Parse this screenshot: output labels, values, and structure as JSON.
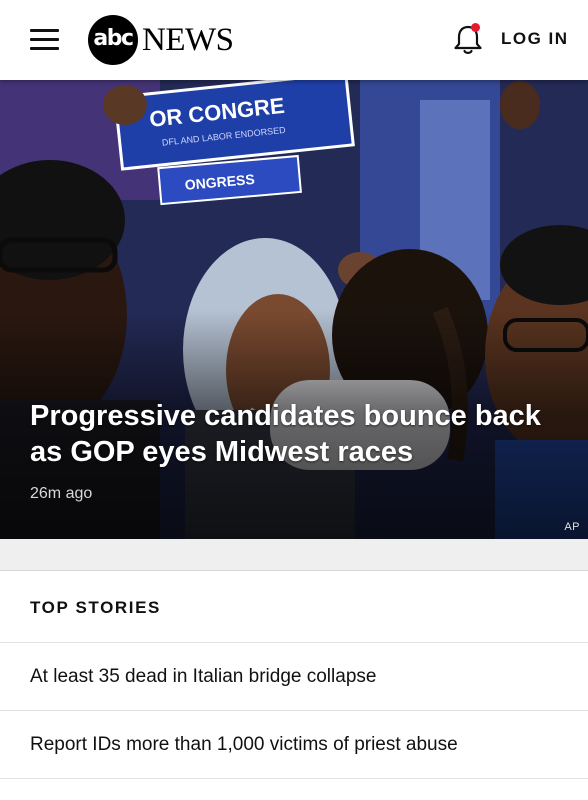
{
  "header": {
    "logo_mark": "abc",
    "logo_text": "NEWS",
    "login_label": "LOG IN",
    "menu_icon": "hamburger-menu-icon",
    "notification_icon": "bell-icon",
    "notification_dot_color": "#e8192c"
  },
  "hero": {
    "headline": "Progressive candidates bounce back as GOP eyes Midwest races",
    "timestamp": "26m ago",
    "credit": "AP",
    "sign_text_1": "OR CONGRE",
    "sign_text_2": "DFL AND LABOR ENDORSED",
    "sign_text_3": "ONGRESS"
  },
  "top_stories": {
    "title": "TOP STORIES",
    "items": [
      {
        "headline": "At least 35 dead in Italian bridge collapse"
      },
      {
        "headline": "Report IDs more than 1,000 victims of priest abuse"
      }
    ]
  }
}
